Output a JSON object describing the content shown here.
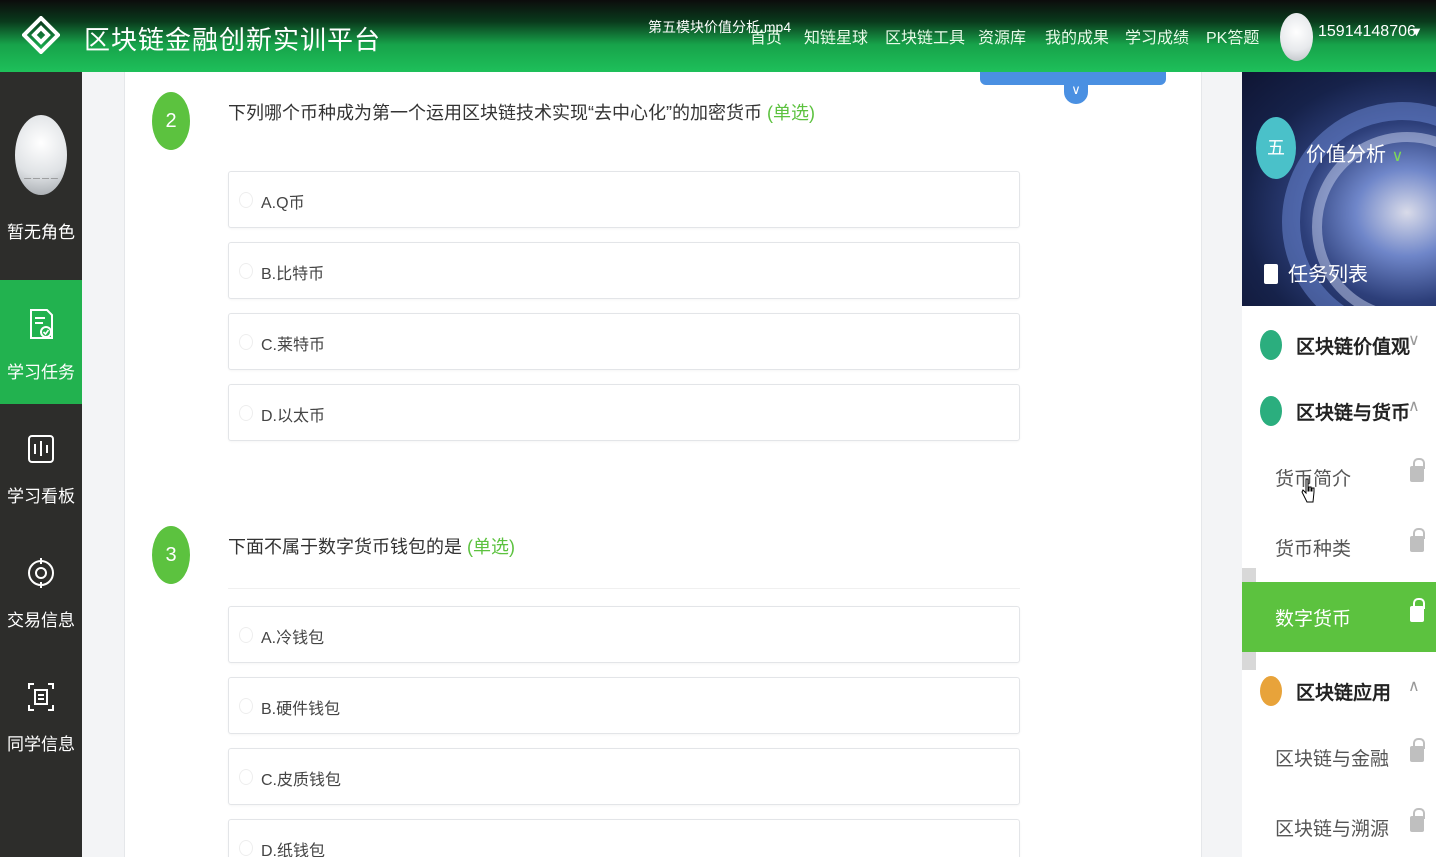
{
  "header": {
    "brand": "区块链金融创新实训平台",
    "video_title": "第五模块价值分析.mp4",
    "nav": [
      "首页",
      "知链星球",
      "区块链工具",
      "资源库",
      "我的成果",
      "学习成绩",
      "PK答题"
    ],
    "user_phone": "15914148706",
    "caret": "▼"
  },
  "sidebar": {
    "role": "暂无角色",
    "items": [
      {
        "label": "学习任务",
        "icon": "task-doc-icon",
        "active": true
      },
      {
        "label": "学习看板",
        "icon": "dashboard-icon",
        "active": false
      },
      {
        "label": "交易信息",
        "icon": "exchange-icon",
        "active": false
      },
      {
        "label": "同学信息",
        "icon": "classmate-icon",
        "active": false
      }
    ]
  },
  "questions": [
    {
      "number": "2",
      "text": "下列哪个币种成为第一个运用区块链技术实现“去中心化”的加密货币",
      "type": "(单选)",
      "options": [
        "A.Q币",
        "B.比特币",
        "C.莱特币",
        "D.以太币"
      ]
    },
    {
      "number": "3",
      "text": "下面不属于数字货币钱包的是",
      "type": "(单选)",
      "options": [
        "A.冷钱包",
        "B.硬件钱包",
        "C.皮质钱包",
        "D.纸钱包"
      ]
    }
  ],
  "right_panel": {
    "module_number": "五",
    "module_title": "价值分析",
    "task_list": "任务列表",
    "sections": [
      {
        "title": "区块链价值观",
        "expanded": false,
        "icon_color": "#2bae7e"
      },
      {
        "title": "区块链与货币",
        "expanded": true,
        "icon_color": "#2bae7e",
        "items": [
          {
            "title": "货币简介",
            "active": false
          },
          {
            "title": "货币种类",
            "active": false
          },
          {
            "title": "数字货币",
            "active": true
          }
        ]
      },
      {
        "title": "区块链应用",
        "expanded": true,
        "icon_color": "#e8a33a",
        "items": [
          {
            "title": "区块链与金融",
            "active": false
          },
          {
            "title": "区块链与溯源",
            "active": false
          }
        ]
      }
    ]
  },
  "colors": {
    "primary_green": "#5cc23f",
    "nav_active_green": "#22b24f",
    "accent_blue": "#4a90e2"
  }
}
